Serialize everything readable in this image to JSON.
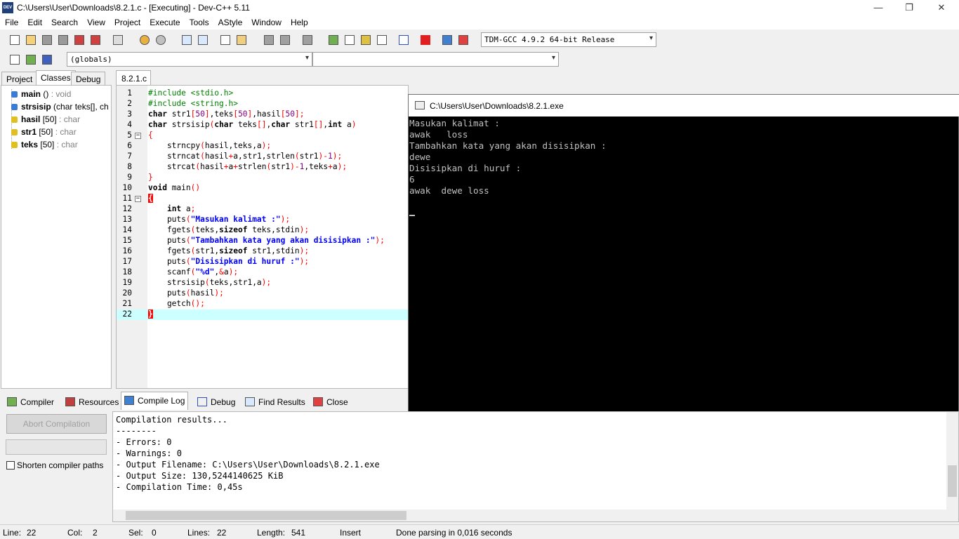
{
  "window": {
    "title": "C:\\Users\\User\\Downloads\\8.2.1.c - [Executing] - Dev-C++ 5.11",
    "icon_label": "DEV",
    "controls": {
      "minimize": "—",
      "restore": "❐",
      "close": "✕"
    }
  },
  "menu": [
    "File",
    "Edit",
    "Search",
    "View",
    "Project",
    "Execute",
    "Tools",
    "AStyle",
    "Window",
    "Help"
  ],
  "toolbar": {
    "compiler_select": "TDM-GCC 4.9.2 64-bit Release",
    "scope_select": "(globals)",
    "member_select": ""
  },
  "left_tabs": [
    "Project",
    "Classes",
    "Debug"
  ],
  "classes": [
    {
      "name": "main",
      "sig": " () ",
      "type": ": void",
      "color": "#3a7bd5"
    },
    {
      "name": "strsisip",
      "sig": " (char teks[], ch",
      "type": "",
      "color": "#3a7bd5"
    },
    {
      "name": "hasil",
      "sig": " [50] ",
      "type": ": char",
      "color": "#e0c020"
    },
    {
      "name": "str1",
      "sig": " [50] ",
      "type": ": char",
      "color": "#e0c020"
    },
    {
      "name": "teks",
      "sig": " [50] ",
      "type": ": char",
      "color": "#e0c020"
    }
  ],
  "editor": {
    "tab": "8.2.1.c",
    "lines": [
      {
        "n": "1",
        "html": "<span class=\"pp\">#include &lt;stdio.h&gt;</span>"
      },
      {
        "n": "2",
        "html": "<span class=\"pp\">#include &lt;string.h&gt;</span>"
      },
      {
        "n": "3",
        "html": "<span class=\"kw\">char</span> str1<span class=\"sym\">[</span><span class=\"num\">50</span><span class=\"sym\">]</span>,teks<span class=\"sym\">[</span><span class=\"num\">50</span><span class=\"sym\">]</span>,hasil<span class=\"sym\">[</span><span class=\"num\">50</span><span class=\"sym\">]</span><span class=\"sym\">;</span>"
      },
      {
        "n": "4",
        "html": "<span class=\"kw\">char</span> strsisip<span class=\"sym\">(</span><span class=\"kw\">char</span> teks<span class=\"sym\">[]</span>,<span class=\"kw\">char</span> str1<span class=\"sym\">[]</span>,<span class=\"kw\">int</span> a<span class=\"sym\">)</span>"
      },
      {
        "n": "5",
        "html": "<span class=\"sym\">{</span>",
        "fold": "−"
      },
      {
        "n": "6",
        "html": "    strncpy<span class=\"sym\">(</span>hasil,teks,a<span class=\"sym\">);</span>"
      },
      {
        "n": "7",
        "html": "    strncat<span class=\"sym\">(</span>hasil<span class=\"sym\">+</span>a,str1,strlen<span class=\"sym\">(</span>str1<span class=\"sym\">)-</span><span class=\"num\">1</span><span class=\"sym\">);</span>"
      },
      {
        "n": "8",
        "html": "    strcat<span class=\"sym\">(</span>hasil<span class=\"sym\">+</span>a<span class=\"sym\">+</span>strlen<span class=\"sym\">(</span>str1<span class=\"sym\">)-</span><span class=\"num\">1</span>,teks<span class=\"sym\">+</span>a<span class=\"sym\">);</span>"
      },
      {
        "n": "9",
        "html": "<span class=\"sym\">}</span>"
      },
      {
        "n": "10",
        "html": "<span class=\"kw\">void</span> main<span class=\"sym\">()</span>"
      },
      {
        "n": "11",
        "html": "<span class=\"brace-hl\">{</span>",
        "fold": "−"
      },
      {
        "n": "12",
        "html": "    <span class=\"kw\">int</span> a<span class=\"sym\">;</span>"
      },
      {
        "n": "13",
        "html": "    puts<span class=\"sym\">(</span><span class=\"str\">\"Masukan kalimat :\"</span><span class=\"sym\">);</span>"
      },
      {
        "n": "14",
        "html": "    fgets<span class=\"sym\">(</span>teks,<span class=\"kw\">sizeof</span> teks,stdin<span class=\"sym\">);</span>"
      },
      {
        "n": "15",
        "html": "    puts<span class=\"sym\">(</span><span class=\"str\">\"Tambahkan kata yang akan disisipkan :\"</span><span class=\"sym\">);</span>"
      },
      {
        "n": "16",
        "html": "    fgets<span class=\"sym\">(</span>str1,<span class=\"kw\">sizeof</span> str1,stdin<span class=\"sym\">);</span>"
      },
      {
        "n": "17",
        "html": "    puts<span class=\"sym\">(</span><span class=\"str\">\"Disisipkan di huruf :\"</span><span class=\"sym\">);</span>"
      },
      {
        "n": "18",
        "html": "    scanf<span class=\"sym\">(</span><span class=\"str\">\"%d\"</span>,<span class=\"sym\">&amp;</span>a<span class=\"sym\">);</span>"
      },
      {
        "n": "19",
        "html": "    strsisip<span class=\"sym\">(</span>teks,str1,a<span class=\"sym\">);</span>"
      },
      {
        "n": "20",
        "html": "    puts<span class=\"sym\">(</span>hasil<span class=\"sym\">);</span>"
      },
      {
        "n": "21",
        "html": "    getch<span class=\"sym\">();</span>"
      },
      {
        "n": "22",
        "html": "<span class=\"brace-hl\">}</span>",
        "current": true
      }
    ]
  },
  "console": {
    "title": "C:\\Users\\User\\Downloads\\8.2.1.exe",
    "output": "Masukan kalimat :\nawak   loss\nTambahkan kata yang akan disisipkan :\ndewe\nDisisipkan di huruf :\n6\nawak  dewe loss"
  },
  "bottom_tabs": [
    "Compiler",
    "Resources",
    "Compile Log",
    "Debug",
    "Find Results",
    "Close"
  ],
  "compile": {
    "abort_label": "Abort Compilation",
    "shorten_label": "Shorten compiler paths",
    "log": "Compilation results...\n--------\n- Errors: 0\n- Warnings: 0\n- Output Filename: C:\\Users\\User\\Downloads\\8.2.1.exe\n- Output Size: 130,5244140625 KiB\n- Compilation Time: 0,45s"
  },
  "status": {
    "line_label": "Line:",
    "line": "22",
    "col_label": "Col:",
    "col": "2",
    "sel_label": "Sel:",
    "sel": "0",
    "lines_label": "Lines:",
    "lines": "22",
    "length_label": "Length:",
    "length": "541",
    "mode": "Insert",
    "message": "Done parsing in 0,016 seconds"
  }
}
